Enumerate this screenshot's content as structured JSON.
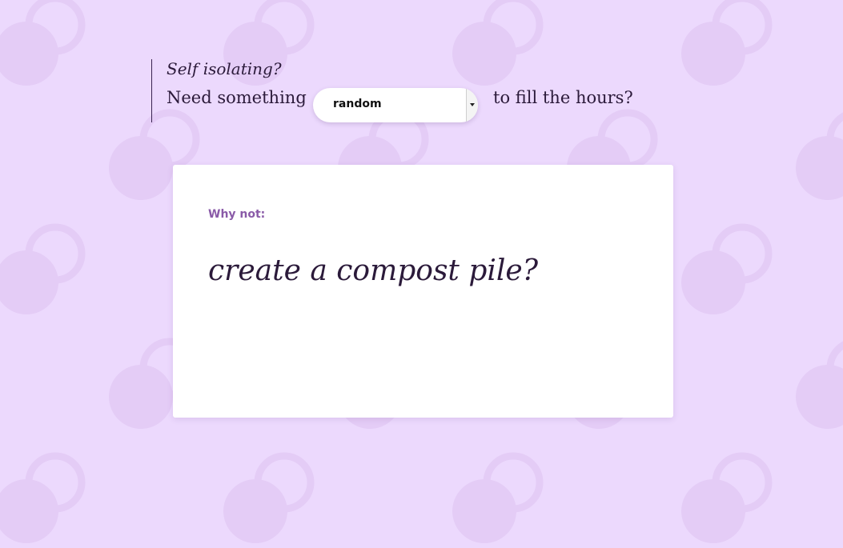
{
  "header": {
    "tagline": "Self isolating?",
    "lead_text": "Need something",
    "trail_text": "to fill the hours?",
    "category_select": {
      "selected": "random",
      "arrow_icon": "caret-down-icon"
    }
  },
  "card": {
    "label": "Why not:",
    "suggestion": "create a compost pile?"
  },
  "background": {
    "pattern_icon": "overlapping-circles-pattern",
    "base_color": "#ecd9fd",
    "pattern_color": "#e4ccf6"
  },
  "colors": {
    "text": "#2b1a3a",
    "accent": "#8a5ba8",
    "card": "#ffffff"
  }
}
